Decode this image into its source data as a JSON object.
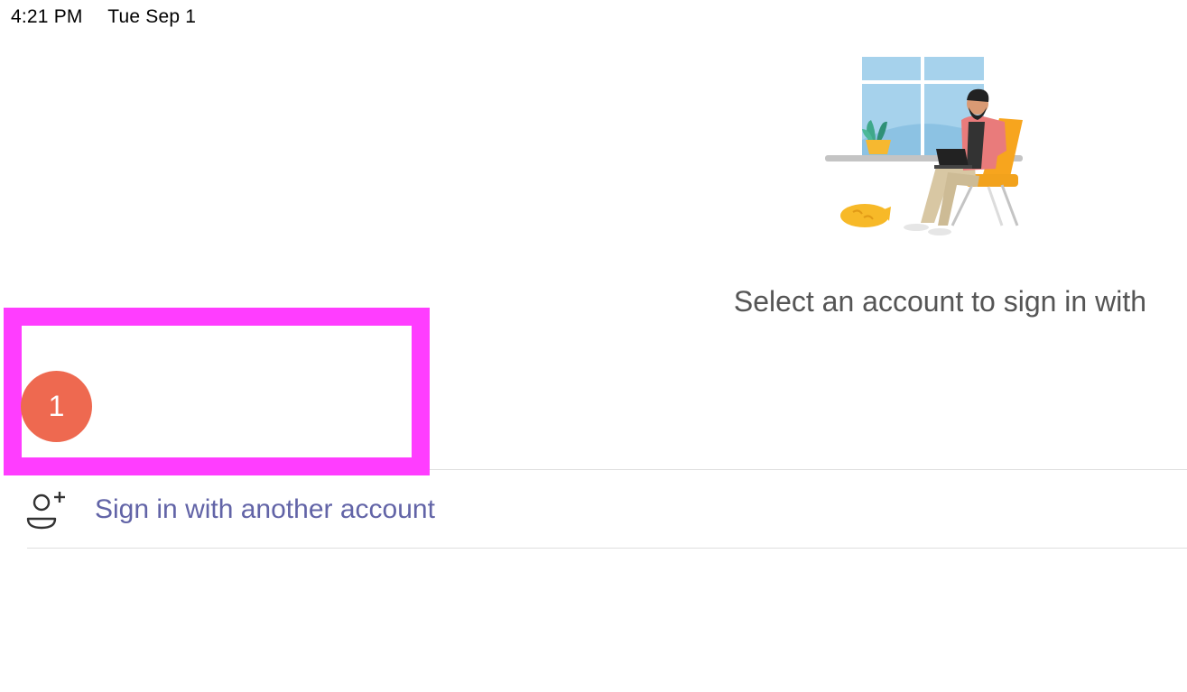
{
  "status_bar": {
    "time": "4:21 PM",
    "date": "Tue Sep 1"
  },
  "illustration": {
    "name": "person-working-on-laptop-illustration"
  },
  "prompt": {
    "title": "Select an account to sign in with"
  },
  "annotation": {
    "step_number": "1",
    "box_color": "#ff3dff",
    "badge_color": "#ee6950"
  },
  "actions": {
    "another_account_label": "Sign in with another account",
    "another_account_icon": "add-person-icon"
  },
  "colors": {
    "accent": "#6264a7",
    "title_text": "#555555",
    "divider": "#dedede"
  }
}
